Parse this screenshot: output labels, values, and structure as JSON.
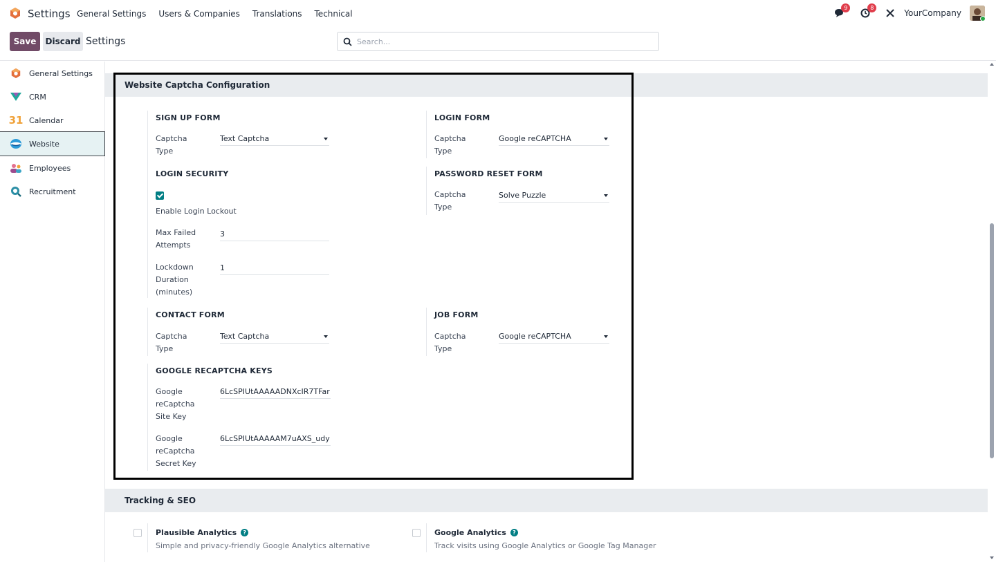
{
  "nav": {
    "app_title": "Settings",
    "menu": [
      "General Settings",
      "Users & Companies",
      "Translations",
      "Technical"
    ],
    "messages_count": "9",
    "activities_count": "8",
    "company": "YourCompany"
  },
  "control_panel": {
    "save": "Save",
    "discard": "Discard",
    "title": "Settings",
    "search_placeholder": "Search..."
  },
  "sidebar": {
    "items": [
      {
        "label": "General Settings",
        "icon": "odoo-logo-icon"
      },
      {
        "label": "CRM",
        "icon": "crm-icon"
      },
      {
        "label": "Calendar",
        "icon": "calendar-icon"
      },
      {
        "label": "Website",
        "icon": "website-icon",
        "active": true
      },
      {
        "label": "Employees",
        "icon": "employees-icon"
      },
      {
        "label": "Recruitment",
        "icon": "recruitment-icon"
      }
    ]
  },
  "captcha": {
    "header": "Website Captcha Configuration",
    "signup": {
      "title": "SIGN UP FORM",
      "captcha_label": "Captcha\nType",
      "value": "Text Captcha"
    },
    "login": {
      "title": "LOGIN FORM",
      "captcha_label": "Captcha\nType",
      "value": "Google reCAPTCHA"
    },
    "security": {
      "title": "LOGIN SECURITY",
      "lockout_label": "Enable Login Lockout",
      "lockout_checked": true,
      "max_failed_label": "Max Failed\nAttempts",
      "max_failed_value": "3",
      "duration_label": "Lockdown\nDuration\n(minutes)",
      "duration_value": "1"
    },
    "password_reset": {
      "title": "PASSWORD RESET FORM",
      "captcha_label": "Captcha\nType",
      "value": "Solve Puzzle"
    },
    "contact": {
      "title": "CONTACT FORM",
      "captcha_label": "Captcha\nType",
      "value": "Text Captcha"
    },
    "job": {
      "title": "JOB FORM",
      "captcha_label": "Captcha\nType",
      "value": "Google reCAPTCHA"
    },
    "keys": {
      "title": "GOOGLE RECAPTCHA KEYS",
      "site_key_label": "Google\nreCaptcha\nSite Key",
      "site_key_value": "6LcSPIUtAAAAADNXcIR7TFar",
      "secret_key_label": "Google\nreCaptcha\nSecret Key",
      "secret_key_value": "6LcSPIUtAAAAAM7uAXS_udy"
    }
  },
  "tracking": {
    "header": "Tracking & SEO",
    "plausible": {
      "title": "Plausible Analytics",
      "desc": "Simple and privacy-friendly Google Analytics alternative",
      "checked": false
    },
    "google": {
      "title": "Google Analytics",
      "desc": "Track visits using Google Analytics or Google Tag Manager",
      "checked": false
    }
  },
  "colors": {
    "primary": "#714b67",
    "accent": "#017e84",
    "badge": "#e03d4b"
  }
}
